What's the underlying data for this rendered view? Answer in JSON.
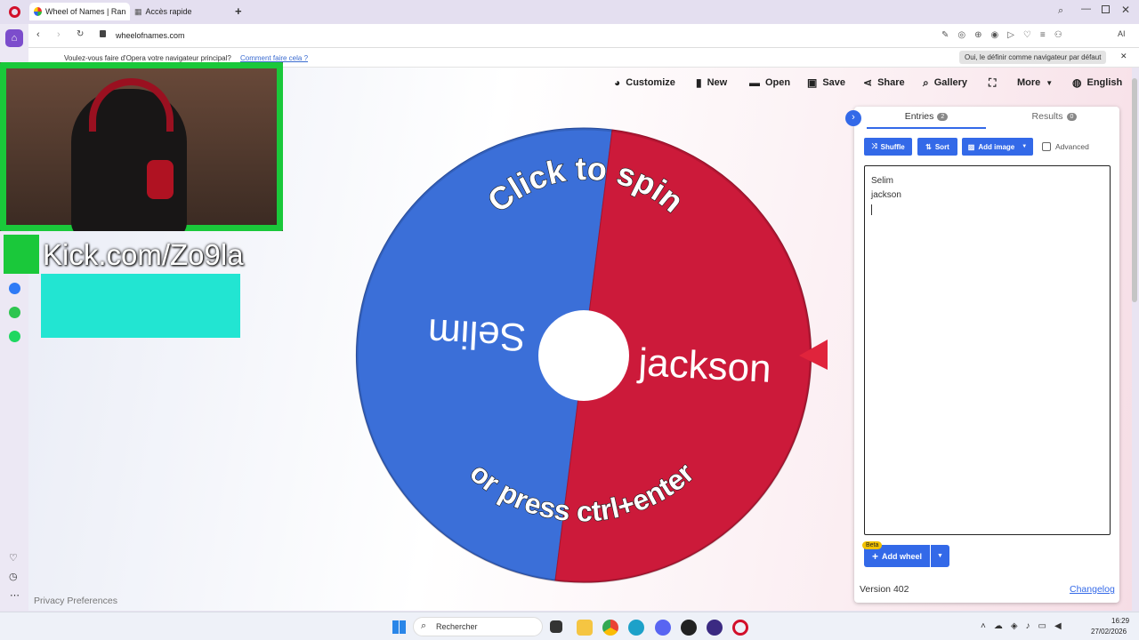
{
  "browser": {
    "tabs": [
      {
        "title": "Wheel of Names | Rando",
        "active": true
      },
      {
        "title": "Accès rapide",
        "active": false
      }
    ],
    "url": "wheelofnames.com",
    "notice": {
      "text": "Voulez-vous faire d'Opera votre navigateur principal?",
      "link": "Comment faire cela ?",
      "button": "Oui, le définir comme navigateur par défaut"
    },
    "ai_label": "AI"
  },
  "toolbar": {
    "customize": "Customize",
    "new": "New",
    "open": "Open",
    "save": "Save",
    "share": "Share",
    "gallery": "Gallery",
    "more": "More",
    "language": "English"
  },
  "wheel": {
    "top_text": "Click to spin",
    "bottom_text": "or press ctrl+enter",
    "segments": [
      {
        "label": "Selim",
        "color": "#3b6fd8"
      },
      {
        "label": "jackson",
        "color": "#cc1a3a"
      }
    ]
  },
  "panel": {
    "tab_entries": "Entries",
    "entries_count": "2",
    "tab_results": "Results",
    "results_count": "0",
    "shuffle": "Shuffle",
    "sort": "Sort",
    "add_image": "Add image",
    "advanced": "Advanced",
    "entries": [
      "Selim",
      "jackson"
    ],
    "beta": "Beta",
    "add_wheel": "Add wheel",
    "version": "Version 402",
    "changelog": "Changelog"
  },
  "overlay": {
    "kick_text": "Kick.com/Zo9la"
  },
  "footer": {
    "privacy": "Privacy Preferences"
  },
  "taskbar": {
    "search_placeholder": "Rechercher",
    "time": "16:29",
    "date": "27/02/2026"
  },
  "colors": {
    "accent_blue": "#3369e8",
    "wheel_blue": "#3b6fd8",
    "wheel_red": "#cc1a3a",
    "overlay_cyan": "#22e5d2"
  }
}
